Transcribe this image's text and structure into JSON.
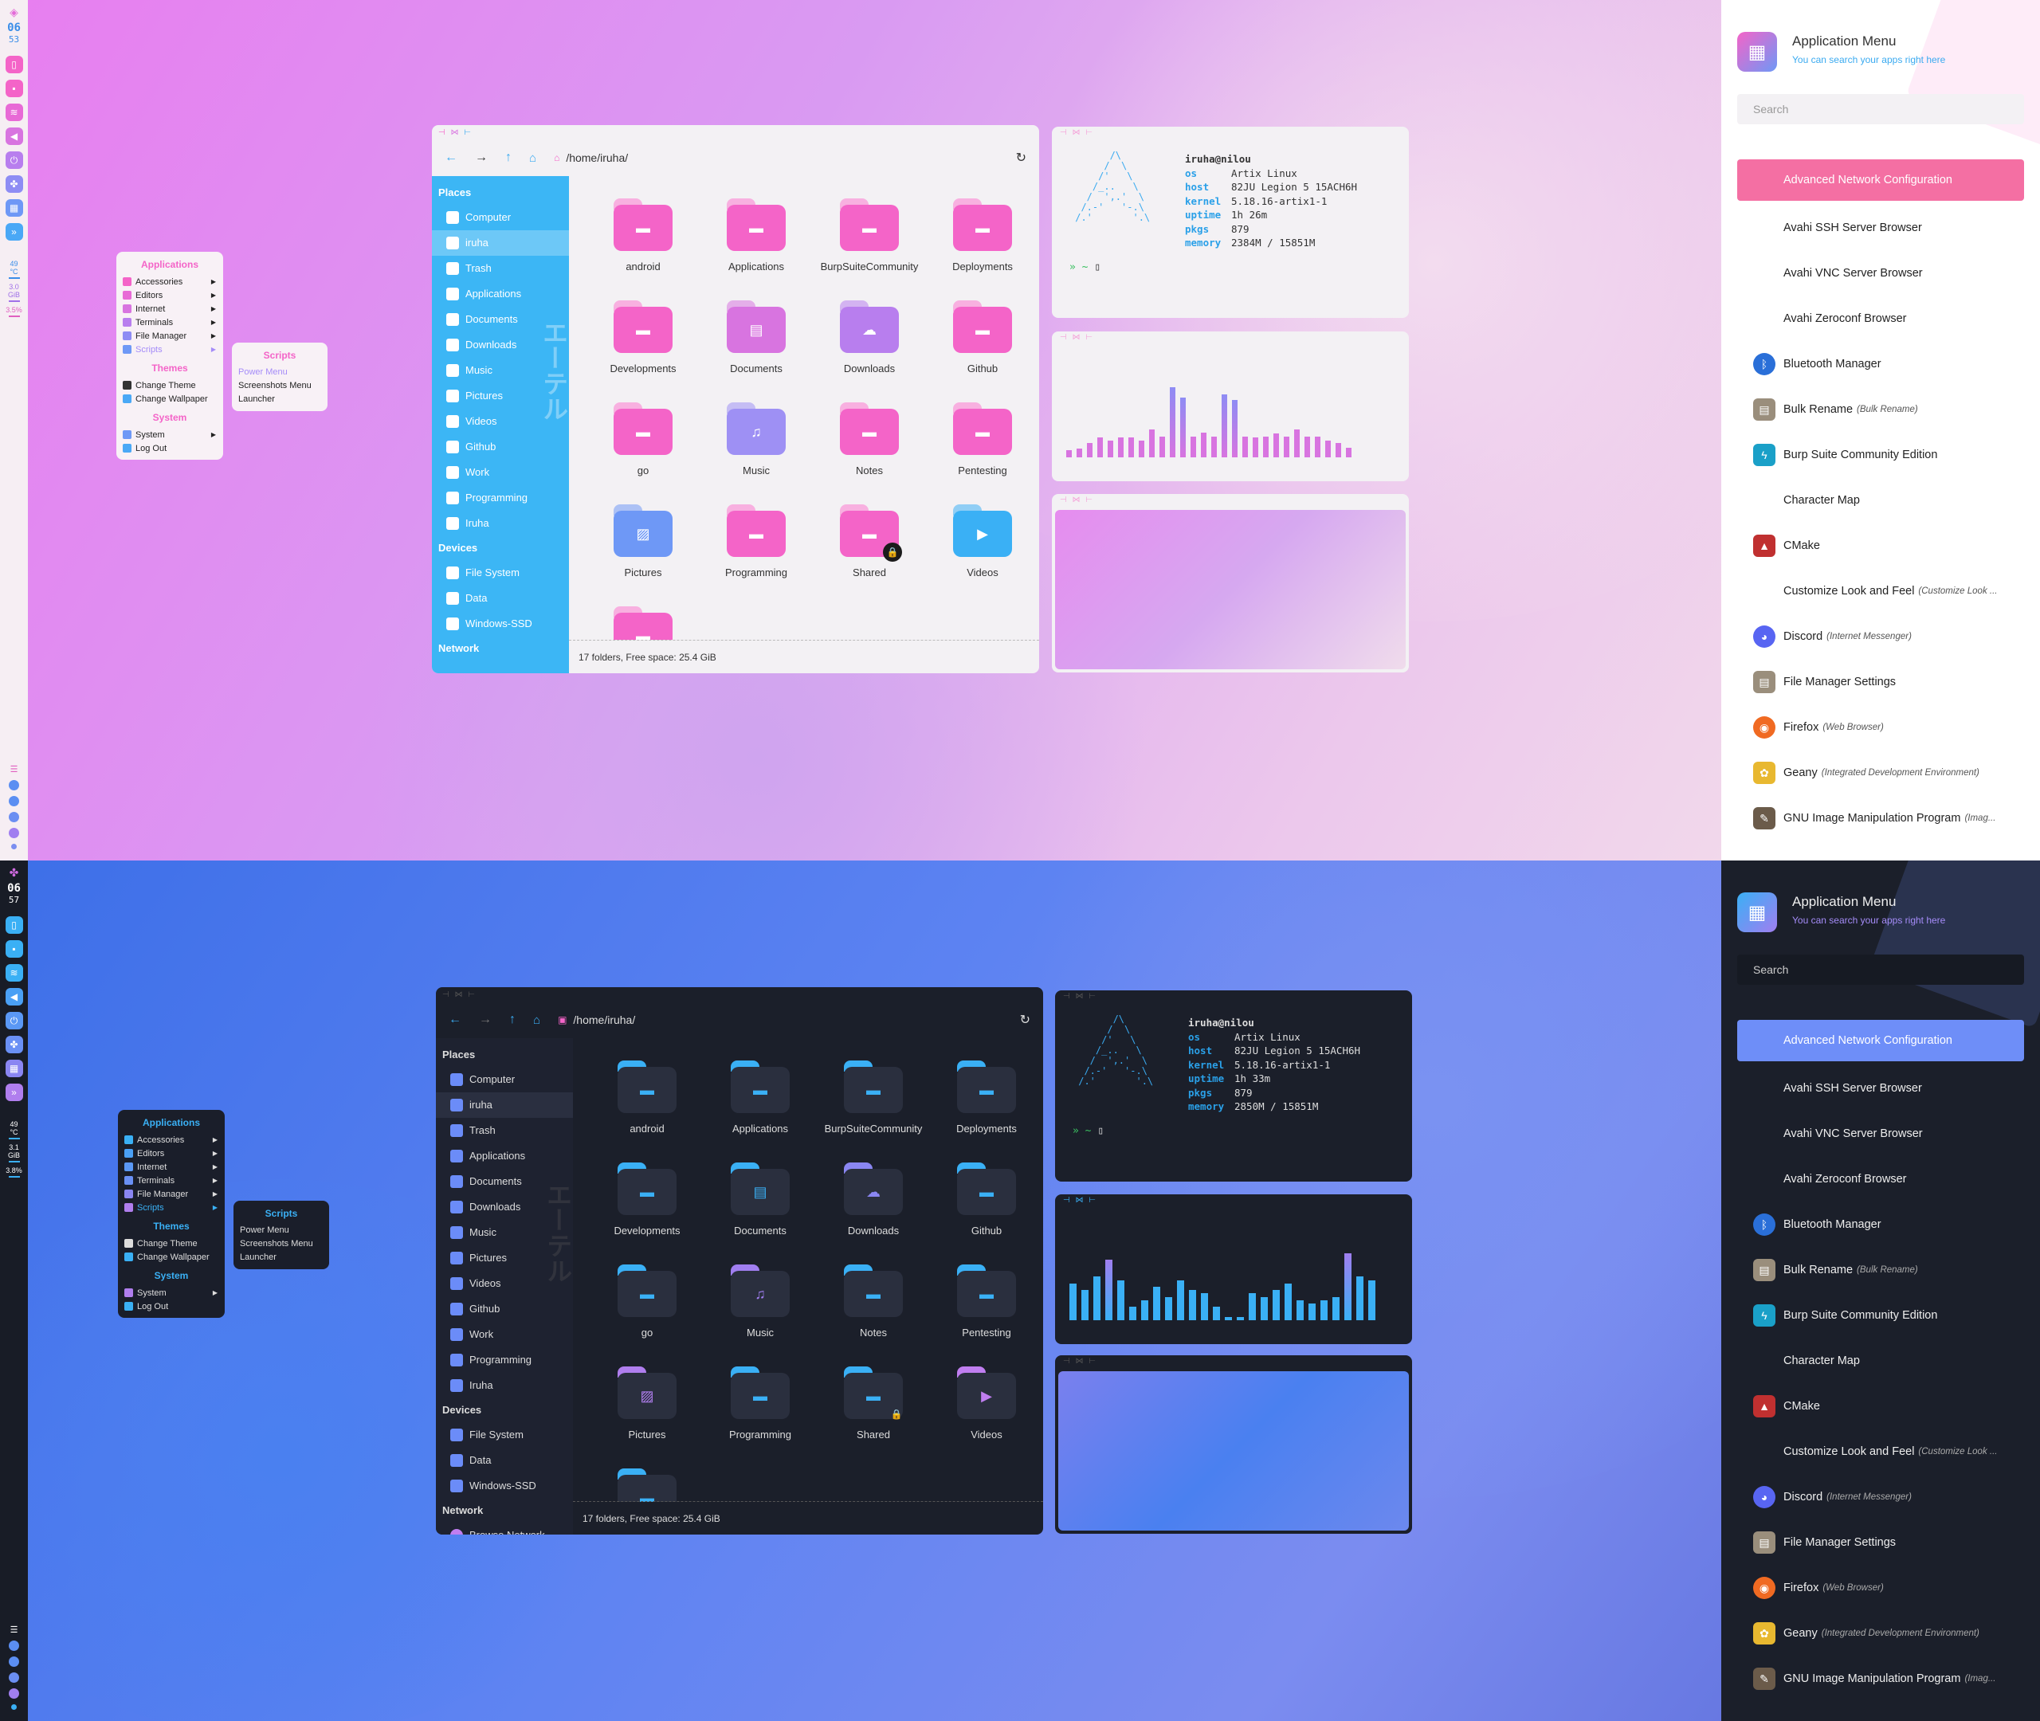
{
  "colors": {
    "pink": "#f464c8",
    "blue": "#3ab0f5",
    "purple": "#a37ef0",
    "indigo": "#6e8ef8"
  },
  "bar_top": {
    "hour": "06",
    "min": "53",
    "temp": "49",
    "temp_unit": "°C",
    "mem": "3.0",
    "mem_unit": "GiB",
    "cpu": "3.5%"
  },
  "bar_bot": {
    "hour": "06",
    "min": "57",
    "temp": "49",
    "temp_unit": "°C",
    "mem": "3.1",
    "mem_unit": "GiB",
    "cpu": "3.8%"
  },
  "appmenu": {
    "applications_heading": "Applications",
    "items": [
      "Accessories",
      "Editors",
      "Internet",
      "Terminals",
      "File Manager",
      "Scripts"
    ],
    "themes_heading": "Themes",
    "themes": [
      "Change Theme",
      "Change Wallpaper"
    ],
    "system_heading": "System",
    "system": [
      "System",
      "Log Out"
    ]
  },
  "scripts": {
    "heading": "Scripts",
    "items": [
      "Power Menu",
      "Screenshots Menu",
      "Launcher"
    ]
  },
  "fm": {
    "path": "/home/iruha/",
    "places_heading": "Places",
    "places": [
      "Computer",
      "iruha",
      "Trash",
      "Applications",
      "Documents",
      "Downloads",
      "Music",
      "Pictures",
      "Videos",
      "Github",
      "Work",
      "Programming",
      "Iruha"
    ],
    "devices_heading": "Devices",
    "devices": [
      "File System",
      "Data",
      "Windows-SSD"
    ],
    "network_heading": "Network",
    "network_item": "Browse Network",
    "folders": [
      "android",
      "Applications",
      "BurpSuiteCommunity",
      "Deployments",
      "Developments",
      "Documents",
      "Downloads",
      "Github",
      "go",
      "Music",
      "Notes",
      "Pentesting",
      "Pictures",
      "Programming",
      "Shared",
      "Videos"
    ],
    "status": "17 folders, Free space: 25.4 GiB",
    "vertical_text": "エーテル"
  },
  "neofetch_top": {
    "user": "iruha@nilou",
    "os": "Artix Linux",
    "host": "82JU Legion 5 15ACH6H",
    "kernel": "5.18.16-artix1-1",
    "uptime": "1h 26m",
    "pkgs": "879",
    "memory": "2384M / 15851M"
  },
  "neofetch_bot": {
    "user": "iruha@nilou",
    "os": "Artix Linux",
    "host": "82JU Legion 5 15ACH6H",
    "kernel": "5.18.16-artix1-1",
    "uptime": "1h 33m",
    "pkgs": "879",
    "memory": "2850M / 15851M"
  },
  "neofetch_labels": {
    "os": "os",
    "host": "host",
    "kernel": "kernel",
    "uptime": "uptime",
    "pkgs": "pkgs",
    "memory": "memory",
    "prompt": "» ~"
  },
  "viz_top": [
    0.1,
    0.12,
    0.2,
    0.28,
    0.24,
    0.28,
    0.28,
    0.24,
    0.4,
    0.3,
    1.0,
    0.85,
    0.3,
    0.35,
    0.3,
    0.9,
    0.82,
    0.3,
    0.28,
    0.3,
    0.34,
    0.3,
    0.4,
    0.3,
    0.3,
    0.24,
    0.2,
    0.14
  ],
  "viz_bot": [
    0.55,
    0.45,
    0.65,
    0.9,
    0.6,
    0.2,
    0.3,
    0.5,
    0.35,
    0.6,
    0.45,
    0.4,
    0.2,
    0.05,
    0.05,
    0.4,
    0.35,
    0.45,
    0.55,
    0.3,
    0.25,
    0.3,
    0.35,
    1.0,
    0.65,
    0.6
  ],
  "rpanel": {
    "title": "Application Menu",
    "subtitle": "You can search your apps right here",
    "search_placeholder": "Search",
    "search_value": "Search",
    "items": [
      {
        "label": "Advanced Network Configuration",
        "ann": "",
        "icon": "",
        "color": ""
      },
      {
        "label": "Avahi SSH Server Browser",
        "ann": "",
        "icon": "",
        "color": ""
      },
      {
        "label": "Avahi VNC Server Browser",
        "ann": "",
        "icon": "",
        "color": ""
      },
      {
        "label": "Avahi Zeroconf Browser",
        "ann": "",
        "icon": "",
        "color": ""
      },
      {
        "label": "Bluetooth Manager",
        "ann": "",
        "icon": "bluetooth-icon",
        "color": "#2a6fd8"
      },
      {
        "label": "Bulk Rename",
        "ann": "(Bulk Rename)",
        "icon": "rename-icon",
        "color": "#9a8e7c"
      },
      {
        "label": "Burp Suite Community Edition",
        "ann": "",
        "icon": "burp-icon",
        "color": "#1aa0c8"
      },
      {
        "label": "Character Map",
        "ann": "",
        "icon": "",
        "color": ""
      },
      {
        "label": "CMake",
        "ann": "",
        "icon": "cmake-icon",
        "color": "#c03030"
      },
      {
        "label": "Customize Look and Feel",
        "ann": "(Customize Look ...",
        "icon": "",
        "color": ""
      },
      {
        "label": "Discord",
        "ann": "(Internet Messenger)",
        "icon": "discord-icon",
        "color": "#5865f2"
      },
      {
        "label": "File Manager Settings",
        "ann": "",
        "icon": "settings-icon",
        "color": "#9a8e7c"
      },
      {
        "label": "Firefox",
        "ann": "(Web Browser)",
        "icon": "firefox-icon",
        "color": "#f06a22"
      },
      {
        "label": "Geany",
        "ann": "(Integrated Development Environment)",
        "icon": "geany-icon",
        "color": "#e8b830"
      },
      {
        "label": "GNU Image Manipulation Program",
        "ann": "(Imag...",
        "icon": "gimp-icon",
        "color": "#6b5b4a"
      }
    ]
  }
}
